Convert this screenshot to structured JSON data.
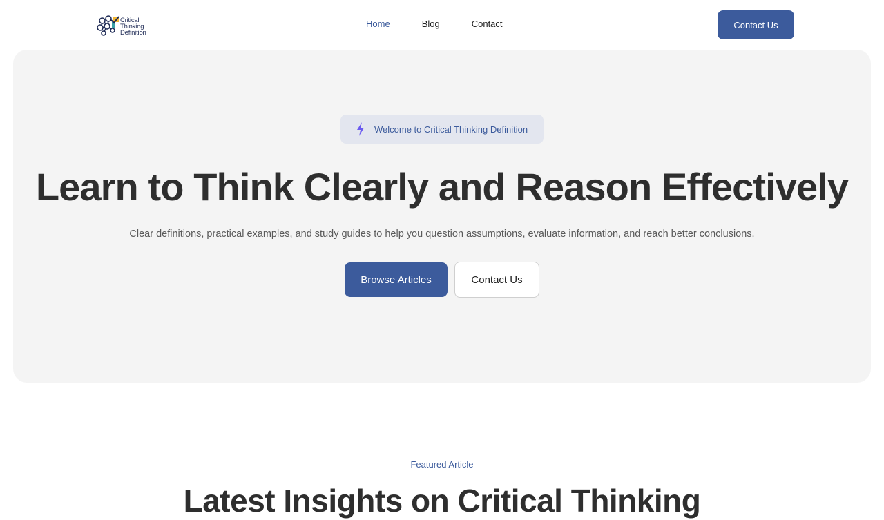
{
  "header": {
    "logo_lines": [
      "Critical",
      "Thinking",
      "Definition"
    ],
    "nav": [
      {
        "label": "Home",
        "active": true
      },
      {
        "label": "Blog",
        "active": false
      },
      {
        "label": "Contact",
        "active": false
      }
    ],
    "cta_label": "Contact Us"
  },
  "hero": {
    "badge_icon": "lightning-icon",
    "badge_text": "Welcome to Critical Thinking Definition",
    "title": "Learn to Think Clearly and Reason Effectively",
    "subtitle": "Clear definitions, practical examples, and study guides to help you question assumptions, evaluate information, and reach better conclusions.",
    "primary_button": "Browse Articles",
    "secondary_button": "Contact Us"
  },
  "featured": {
    "label": "Featured Article",
    "title": "Latest Insights on Critical Thinking"
  },
  "colors": {
    "accent": "#3c5b9c",
    "hero_bg": "#f4f4f4",
    "badge_bg": "#e3e6ef",
    "lightning": "#6b5bf0"
  }
}
